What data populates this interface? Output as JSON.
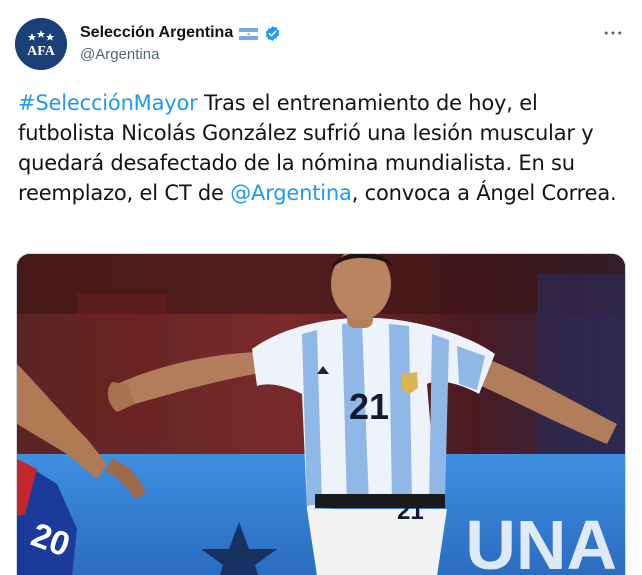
{
  "account": {
    "display_name": "Selección Argentina",
    "handle": "@Argentina",
    "avatar_text": "AFA",
    "flag_icon": "argentina-flag-icon",
    "verified_icon": "verified-badge-icon"
  },
  "more_icon": "more-dots-icon",
  "tweet": {
    "hashtag": "#SelecciónMayor",
    "text_part1": " Tras el entrenamiento de hoy, el futbolista Nicolás González sufrió una lesión muscular y quedará desafectado de la nómina mundialista. En su reemplazo, el CT de ",
    "mention": "@Argentina",
    "text_part2": ",  convoca a Ángel Correa."
  },
  "media": {
    "player_number": "21",
    "short_number": "21",
    "opponent_number": "20",
    "ad_text": "UNA"
  },
  "colors": {
    "link": "#1d9bf0",
    "handle": "#536471",
    "avatar_bg": "#1b3f78",
    "verified": "#1d9bf0",
    "shirt_stripe": "#8fb8e6"
  }
}
